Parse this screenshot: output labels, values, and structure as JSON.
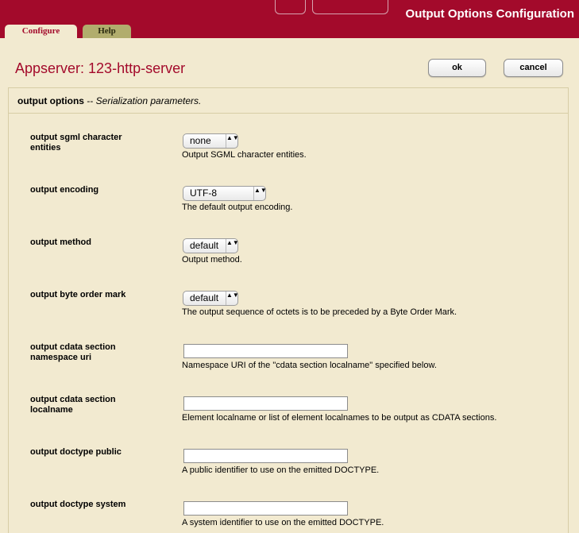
{
  "header": {
    "title": "Output Options Configuration",
    "accent_color": "#a30a2b"
  },
  "tabs": {
    "configure": "Configure",
    "help": "Help"
  },
  "page": {
    "title": "Appserver: 123-http-server"
  },
  "buttons": {
    "ok": "ok",
    "cancel": "cancel"
  },
  "section": {
    "name": "output options",
    "separator": " -- ",
    "description": "Serialization parameters."
  },
  "fields": {
    "sgml": {
      "label": "output sgml character entities",
      "value": "none",
      "description": "Output SGML character entities."
    },
    "encoding": {
      "label": "output encoding",
      "value": "UTF-8",
      "description": "The default output encoding."
    },
    "method": {
      "label": "output method",
      "value": "default",
      "description": "Output method."
    },
    "bom": {
      "label": "output byte order mark",
      "value": "default",
      "description": "The output sequence of octets is to be preceded by a Byte Order Mark."
    },
    "cdata_ns": {
      "label_line1": "output cdata section",
      "label_line2": "namespace uri",
      "value": "",
      "description": "Namespace URI of the \"cdata section localname\" specified below."
    },
    "cdata_local": {
      "label_line1": "output cdata section",
      "label_line2": "localname",
      "value": "",
      "description": "Element localname or list of element localnames to be output as CDATA sections."
    },
    "doctype_public": {
      "label": "output doctype public",
      "value": "",
      "description": "A public identifier to use on the emitted DOCTYPE."
    },
    "doctype_system": {
      "label": "output doctype system",
      "value": "",
      "description": "A system identifier to use on the emitted DOCTYPE."
    }
  },
  "icons": {
    "select_arrow": "updown-arrows-icon",
    "arrow_glyph": "▲▼"
  }
}
